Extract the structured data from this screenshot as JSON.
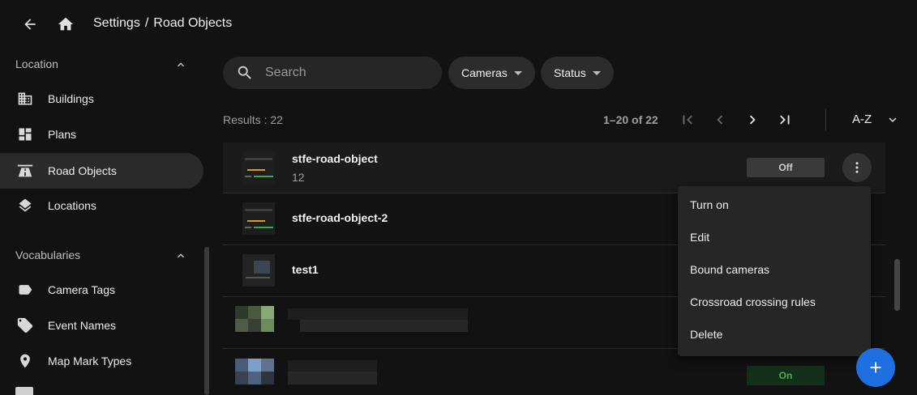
{
  "header": {
    "breadcrumb": {
      "parent": "Settings",
      "separator": "/",
      "current": "Road Objects"
    }
  },
  "sidebar": {
    "sections": [
      {
        "title": "Location",
        "items": [
          {
            "label": "Buildings",
            "icon": "building-icon"
          },
          {
            "label": "Plans",
            "icon": "dashboard-icon"
          },
          {
            "label": "Road Objects",
            "icon": "road-icon",
            "active": true
          },
          {
            "label": "Locations",
            "icon": "layers-icon"
          }
        ]
      },
      {
        "title": "Vocabularies",
        "items": [
          {
            "label": "Camera Tags",
            "icon": "tag-icon"
          },
          {
            "label": "Event Names",
            "icon": "tags-icon"
          },
          {
            "label": "Map Mark Types",
            "icon": "map-pin-icon"
          }
        ]
      }
    ]
  },
  "toolbar": {
    "search_placeholder": "Search",
    "filters": {
      "cameras": "Cameras",
      "status": "Status"
    },
    "results": "Results : 22",
    "range": "1–20 of 22",
    "sort": "A-Z"
  },
  "rows": [
    {
      "name": "stfe-road-object",
      "sub": "12",
      "status": "Off"
    },
    {
      "name": "stfe-road-object-2",
      "sub": ""
    },
    {
      "name": "test1",
      "sub": ""
    },
    {
      "name": "",
      "sub": ""
    },
    {
      "name": "",
      "sub": "",
      "status": "On"
    }
  ],
  "menu": {
    "items": [
      "Turn on",
      "Edit",
      "Bound cameras",
      "Crossroad crossing rules",
      "Delete"
    ]
  },
  "colors": {
    "accent": "#1f6fe0",
    "on": "#4caf50",
    "off_bg": "#3a3a3a",
    "on_bg": "#14301a"
  }
}
